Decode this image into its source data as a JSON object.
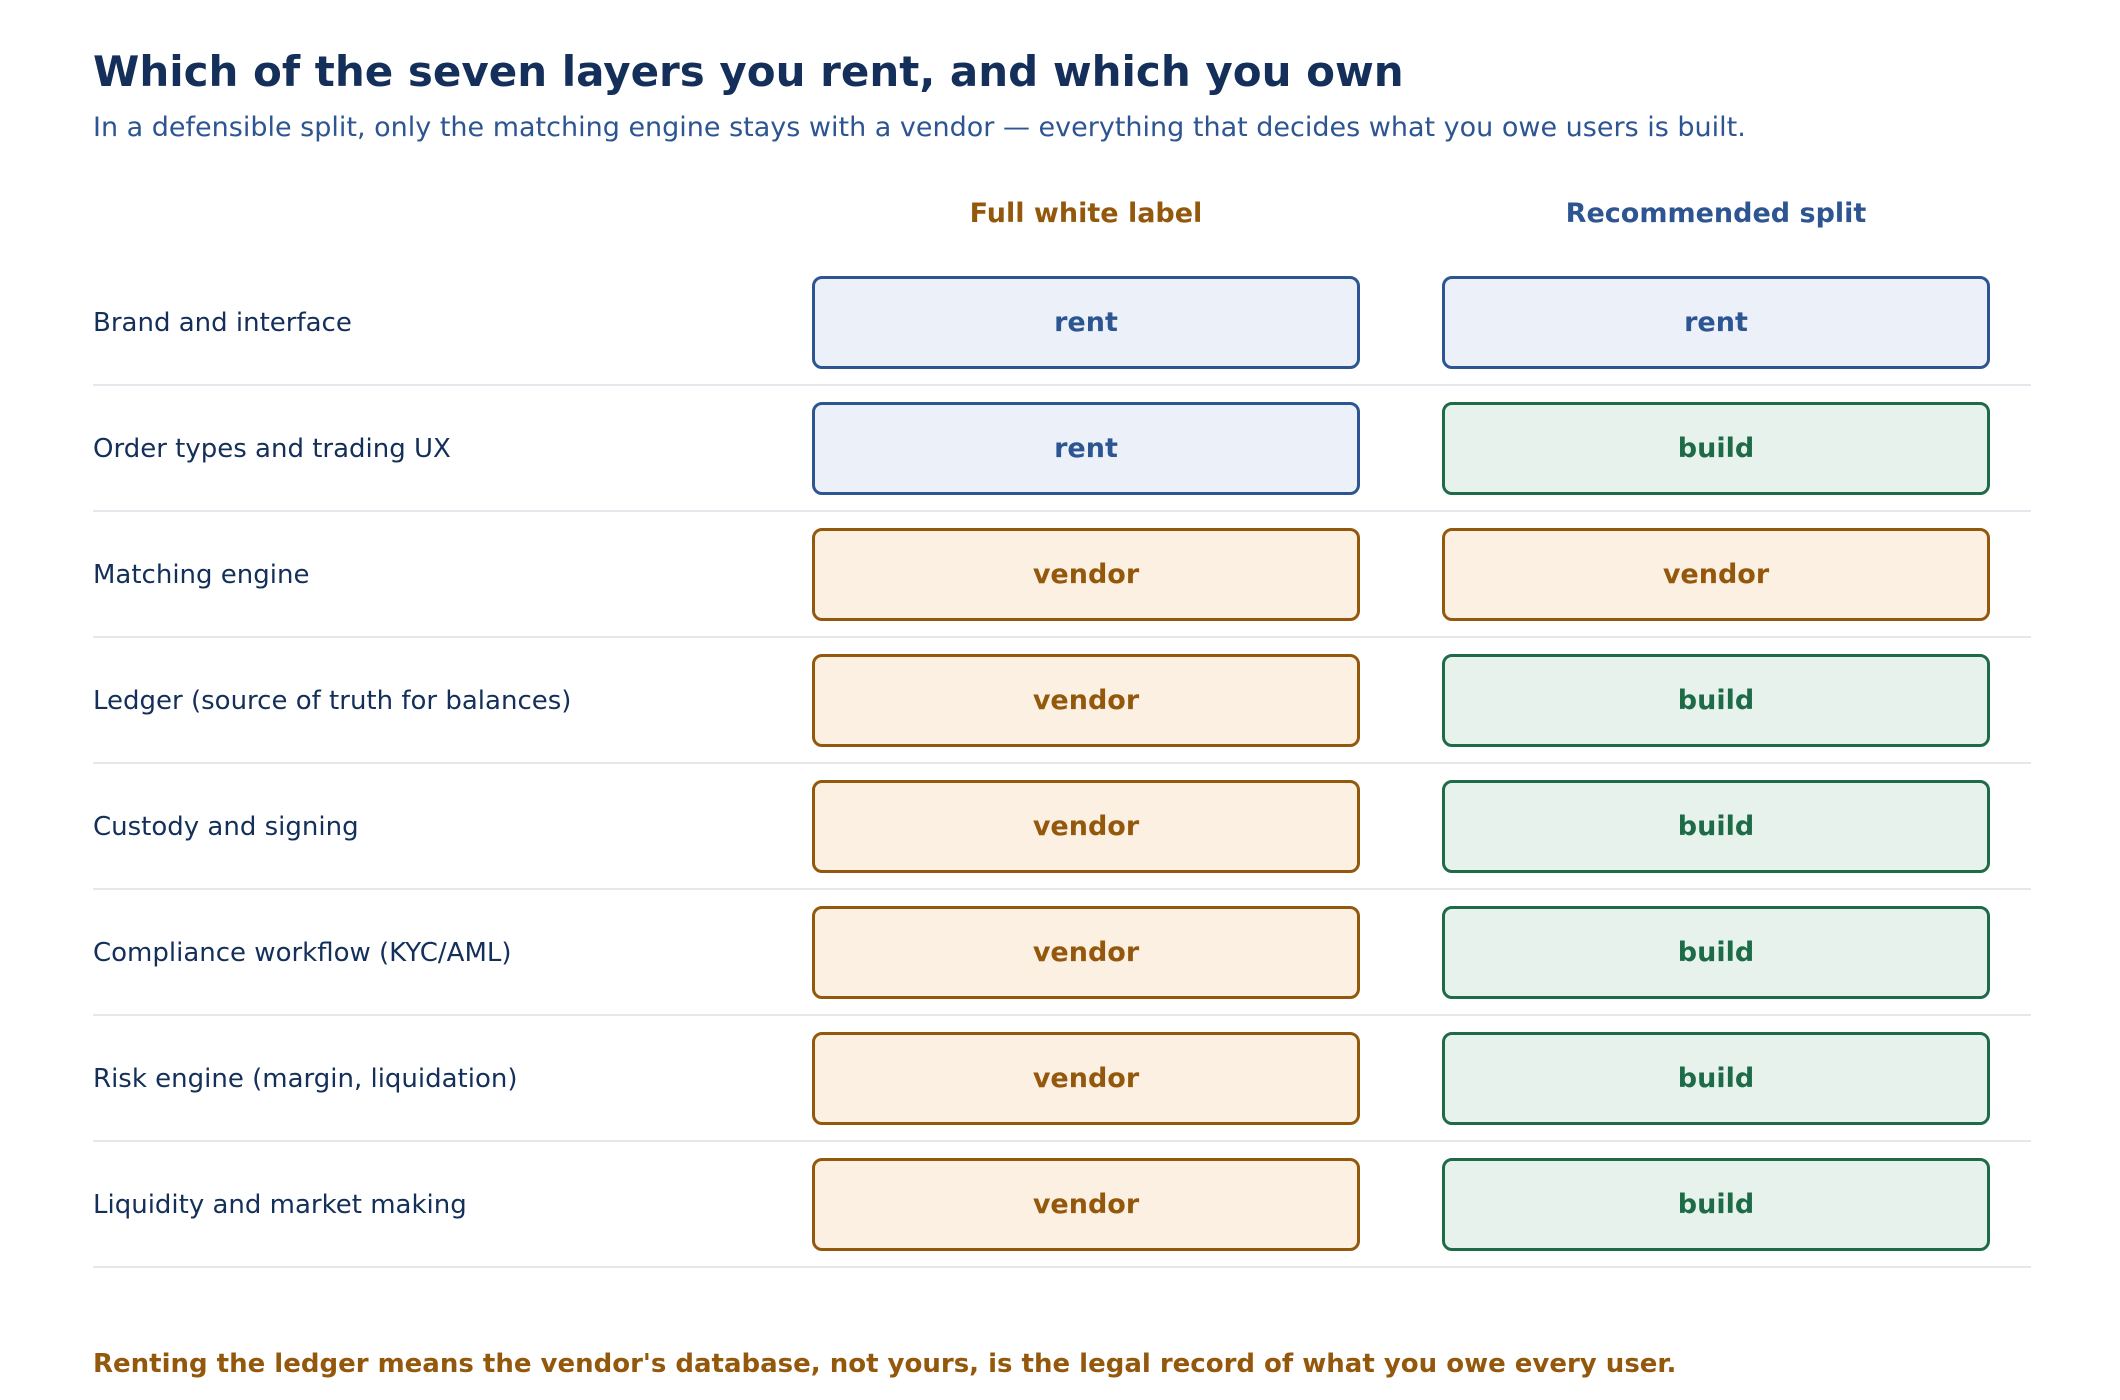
{
  "title": "Which of the seven layers you rent, and which you own",
  "subtitle": "In a defensible split, only the matching engine stays with a vendor — everything that decides what you owe users is built.",
  "columns": {
    "full_white_label": "Full white label",
    "recommended_split": "Recommended split"
  },
  "rows": [
    {
      "layer": "Brand and interface",
      "full_white_label": "rent",
      "recommended_split": "rent"
    },
    {
      "layer": "Order types and trading UX",
      "full_white_label": "rent",
      "recommended_split": "build"
    },
    {
      "layer": "Matching engine",
      "full_white_label": "vendor",
      "recommended_split": "vendor"
    },
    {
      "layer": "Ledger (source of truth for balances)",
      "full_white_label": "vendor",
      "recommended_split": "build"
    },
    {
      "layer": "Custody and signing",
      "full_white_label": "vendor",
      "recommended_split": "build"
    },
    {
      "layer": "Compliance workflow (KYC/AML)",
      "full_white_label": "vendor",
      "recommended_split": "build"
    },
    {
      "layer": "Risk engine (margin, liquidation)",
      "full_white_label": "vendor",
      "recommended_split": "build"
    },
    {
      "layer": "Liquidity and market making",
      "full_white_label": "vendor",
      "recommended_split": "build"
    }
  ],
  "colors": {
    "rent": "#2d5592",
    "build": "#1e6b48",
    "vendor": "#94580d",
    "title": "#14305a"
  },
  "footnote": "Renting the ledger means the vendor's database, not yours, is the legal record of what you owe every user."
}
